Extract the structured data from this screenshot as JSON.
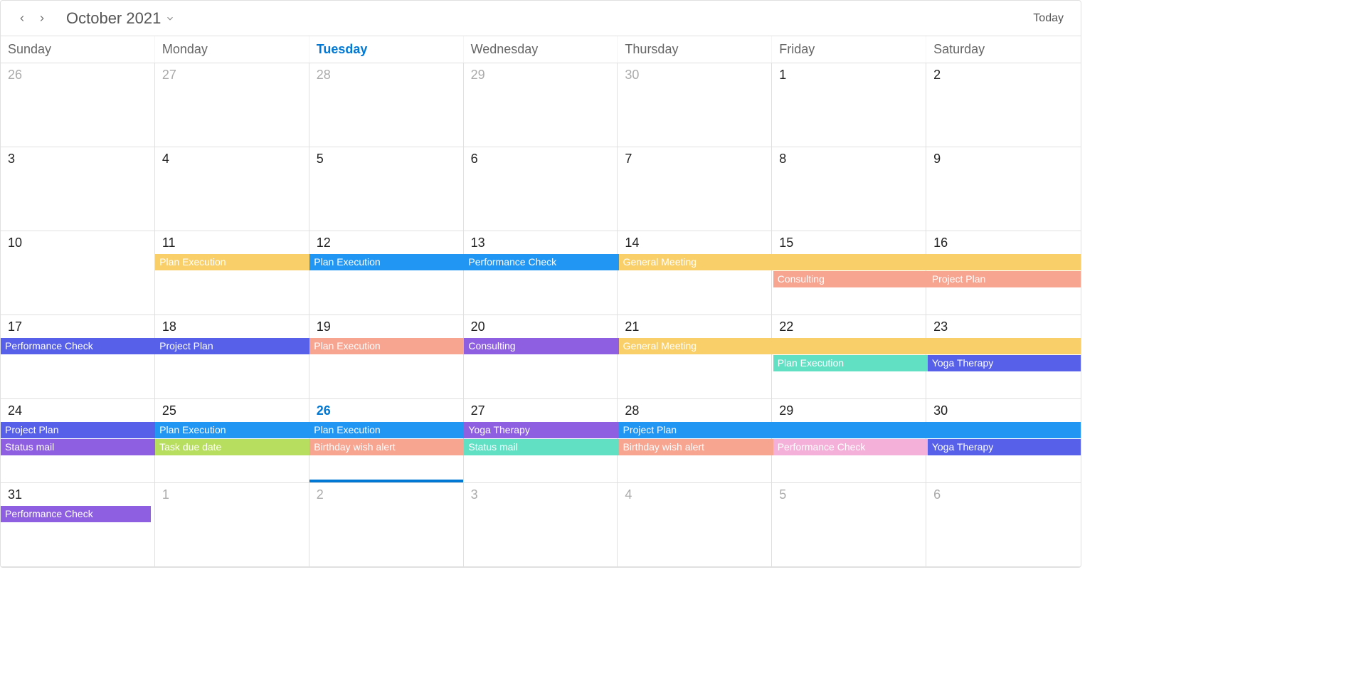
{
  "header": {
    "title": "October 2021",
    "today_label": "Today"
  },
  "weekdays": [
    "Sunday",
    "Monday",
    "Tuesday",
    "Wednesday",
    "Thursday",
    "Friday",
    "Saturday"
  ],
  "current_weekday_index": 2,
  "colors": {
    "amber": "#f9cf6a",
    "blue": "#2196f3",
    "salmon": "#f7a491",
    "indigo": "#5760e9",
    "purple": "#8e5fe0",
    "mint": "#62e0c4",
    "lime": "#b7de5f",
    "pink": "#f5b0d9"
  },
  "days": [
    [
      {
        "n": "26",
        "out": true
      },
      {
        "n": "27",
        "out": true
      },
      {
        "n": "28",
        "out": true
      },
      {
        "n": "29",
        "out": true
      },
      {
        "n": "30",
        "out": true
      },
      {
        "n": "1"
      },
      {
        "n": "2"
      }
    ],
    [
      {
        "n": "3"
      },
      {
        "n": "4"
      },
      {
        "n": "5"
      },
      {
        "n": "6"
      },
      {
        "n": "7"
      },
      {
        "n": "8"
      },
      {
        "n": "9"
      }
    ],
    [
      {
        "n": "10"
      },
      {
        "n": "11"
      },
      {
        "n": "12"
      },
      {
        "n": "13"
      },
      {
        "n": "14"
      },
      {
        "n": "15"
      },
      {
        "n": "16"
      }
    ],
    [
      {
        "n": "17"
      },
      {
        "n": "18"
      },
      {
        "n": "19"
      },
      {
        "n": "20"
      },
      {
        "n": "21"
      },
      {
        "n": "22"
      },
      {
        "n": "23"
      }
    ],
    [
      {
        "n": "24"
      },
      {
        "n": "25"
      },
      {
        "n": "26",
        "today": true
      },
      {
        "n": "27"
      },
      {
        "n": "28"
      },
      {
        "n": "29"
      },
      {
        "n": "30"
      }
    ],
    [
      {
        "n": "31"
      },
      {
        "n": "1",
        "out": true
      },
      {
        "n": "2",
        "out": true
      },
      {
        "n": "3",
        "out": true
      },
      {
        "n": "4",
        "out": true
      },
      {
        "n": "5",
        "out": true
      },
      {
        "n": "6",
        "out": true
      }
    ]
  ],
  "events": [
    {
      "week": 2,
      "row": 0,
      "start": 1,
      "span": 1,
      "label": "Plan Execution",
      "color": "amber"
    },
    {
      "week": 2,
      "row": 0,
      "start": 2,
      "span": 1,
      "label": "Plan Execution",
      "color": "blue"
    },
    {
      "week": 2,
      "row": 0,
      "start": 3,
      "span": 2,
      "label": "Performance Check",
      "color": "blue"
    },
    {
      "week": 2,
      "row": 0,
      "start": 4,
      "span": 3,
      "label": "General Meeting",
      "color": "amber",
      "noLabelOffset": true
    },
    {
      "week": 2,
      "row": 1,
      "start": 5,
      "span": 1,
      "label": "Consulting",
      "color": "salmon"
    },
    {
      "week": 2,
      "row": 1,
      "start": 6,
      "span": 1,
      "label": "Project Plan",
      "color": "salmon"
    },
    {
      "week": 3,
      "row": 0,
      "start": 0,
      "span": 1,
      "label": "Performance Check",
      "color": "indigo"
    },
    {
      "week": 3,
      "row": 0,
      "start": 1,
      "span": 1,
      "label": "Project Plan",
      "color": "indigo"
    },
    {
      "week": 3,
      "row": 0,
      "start": 2,
      "span": 1,
      "label": "Plan Execution",
      "color": "salmon"
    },
    {
      "week": 3,
      "row": 0,
      "start": 3,
      "span": 1,
      "label": "Consulting",
      "color": "purple"
    },
    {
      "week": 3,
      "row": 0,
      "start": 4,
      "span": 3,
      "label": "General Meeting",
      "color": "amber"
    },
    {
      "week": 3,
      "row": 1,
      "start": 5,
      "span": 1,
      "label": "Plan Execution",
      "color": "mint"
    },
    {
      "week": 3,
      "row": 1,
      "start": 6,
      "span": 1,
      "label": "Yoga Therapy",
      "color": "indigo"
    },
    {
      "week": 4,
      "row": 0,
      "start": 0,
      "span": 1,
      "label": "Project Plan",
      "color": "indigo"
    },
    {
      "week": 4,
      "row": 0,
      "start": 1,
      "span": 1,
      "label": "Plan Execution",
      "color": "blue"
    },
    {
      "week": 4,
      "row": 0,
      "start": 2,
      "span": 1,
      "label": "Plan Execution",
      "color": "blue"
    },
    {
      "week": 4,
      "row": 0,
      "start": 3,
      "span": 1,
      "label": "Yoga Therapy",
      "color": "purple"
    },
    {
      "week": 4,
      "row": 0,
      "start": 4,
      "span": 3,
      "label": "Project Plan",
      "color": "blue"
    },
    {
      "week": 4,
      "row": 1,
      "start": 0,
      "span": 1,
      "label": "Status mail",
      "color": "purple"
    },
    {
      "week": 4,
      "row": 1,
      "start": 1,
      "span": 1,
      "label": "Task due date",
      "color": "lime"
    },
    {
      "week": 4,
      "row": 1,
      "start": 2,
      "span": 1,
      "label": "Birthday wish alert",
      "color": "salmon"
    },
    {
      "week": 4,
      "row": 1,
      "start": 3,
      "span": 2,
      "label": "Status mail",
      "color": "mint"
    },
    {
      "week": 4,
      "row": 1,
      "start": 4,
      "span": 1,
      "label": "Birthday wish alert",
      "color": "salmon",
      "noLabelOffset": true
    },
    {
      "week": 4,
      "row": 1,
      "start": 5,
      "span": 1,
      "label": "Performance Check",
      "color": "pink"
    },
    {
      "week": 4,
      "row": 1,
      "start": 6,
      "span": 1,
      "label": "Yoga Therapy",
      "color": "indigo"
    },
    {
      "week": 5,
      "row": 0,
      "start": 0,
      "span": 1,
      "label": "Performance Check",
      "color": "purple",
      "shrink": true
    }
  ]
}
